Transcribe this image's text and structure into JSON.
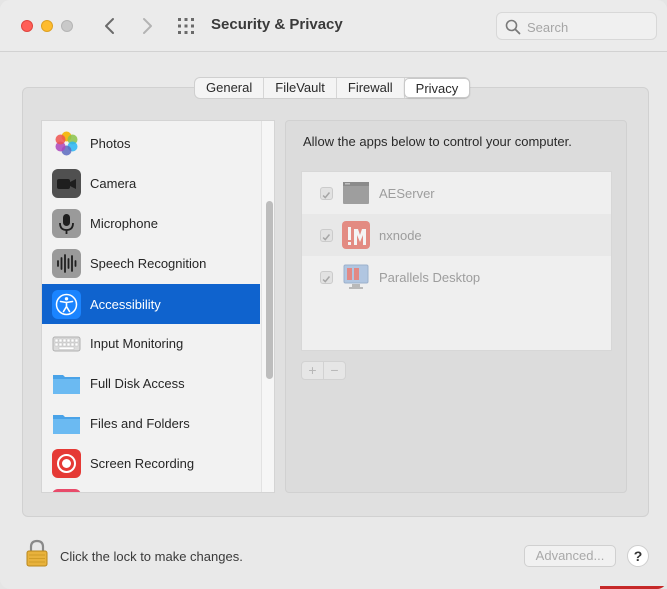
{
  "window": {
    "title": "Security & Privacy",
    "search": {
      "placeholder": "Search"
    }
  },
  "tabs": [
    {
      "label": "General"
    },
    {
      "label": "FileVault"
    },
    {
      "label": "Firewall"
    },
    {
      "label": "Privacy",
      "active": true
    }
  ],
  "sidebar": {
    "items": [
      {
        "label": "Photos",
        "icon": "photos-icon"
      },
      {
        "label": "Camera",
        "icon": "camera-icon"
      },
      {
        "label": "Microphone",
        "icon": "microphone-icon"
      },
      {
        "label": "Speech Recognition",
        "icon": "waveform-icon"
      },
      {
        "label": "Accessibility",
        "icon": "accessibility-icon",
        "selected": true
      },
      {
        "label": "Input Monitoring",
        "icon": "keyboard-icon"
      },
      {
        "label": "Full Disk Access",
        "icon": "folder-icon"
      },
      {
        "label": "Files and Folders",
        "icon": "folder-icon"
      },
      {
        "label": "Screen Recording",
        "icon": "screen-recording-icon"
      }
    ]
  },
  "pane": {
    "heading": "Allow the apps below to control your computer.",
    "apps": [
      {
        "name": "AEServer",
        "checked": true,
        "icon": "aeserver-icon"
      },
      {
        "name": "nxnode",
        "checked": true,
        "icon": "nxnode-icon"
      },
      {
        "name": "Parallels Desktop",
        "checked": true,
        "icon": "parallels-icon"
      }
    ],
    "add_label": "+",
    "remove_label": "−"
  },
  "footer": {
    "lock_text": "Click the lock to make changes.",
    "advanced_label": "Advanced...",
    "help_label": "?"
  },
  "colors": {
    "selection": "#0f63ce",
    "close": "#ff5f57",
    "minimize": "#febc2e"
  }
}
